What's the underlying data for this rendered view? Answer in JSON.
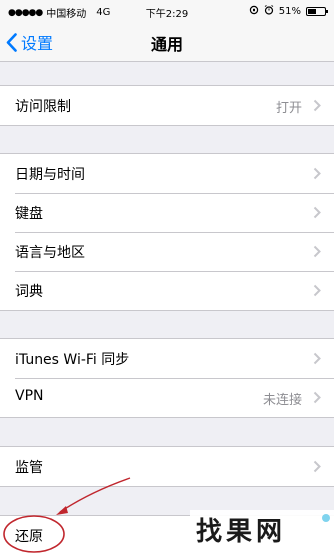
{
  "status_bar": {
    "signal_dots": "●●●●●",
    "carrier": "中国移动",
    "network": "4G",
    "time": "下午2:29",
    "battery": "51%",
    "battery_level": 0.51
  },
  "nav": {
    "back_label": "设置",
    "title": "通用"
  },
  "groups": [
    {
      "rows": [
        {
          "label": "访问限制",
          "detail": "打开"
        }
      ]
    },
    {
      "rows": [
        {
          "label": "日期与时间",
          "detail": ""
        },
        {
          "label": "键盘",
          "detail": ""
        },
        {
          "label": "语言与地区",
          "detail": ""
        },
        {
          "label": "词典",
          "detail": ""
        }
      ]
    },
    {
      "rows": [
        {
          "label": "iTunes Wi-Fi 同步",
          "detail": ""
        },
        {
          "label": "VPN",
          "detail": "未连接"
        }
      ]
    },
    {
      "rows": [
        {
          "label": "监管",
          "detail": ""
        }
      ]
    },
    {
      "rows": [
        {
          "label": "还原",
          "detail": ""
        }
      ]
    }
  ],
  "watermark": {
    "text": "找果网"
  },
  "colors": {
    "accent": "#007aff",
    "annotation": "#c0262d"
  }
}
